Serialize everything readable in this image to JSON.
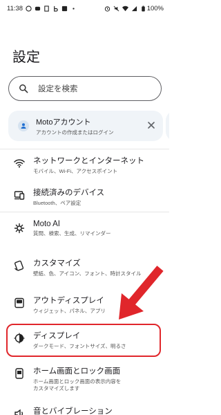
{
  "status_bar": {
    "time": "11:38",
    "battery": "100%",
    "icons_left": [
      "whatsapp-icon",
      "chat-icon",
      "doc-icon",
      "b-icon",
      "linkedin-icon",
      "dot-icon"
    ],
    "icons_right": [
      "alarm-icon",
      "mute-icon",
      "wifi-icon",
      "signal-icon",
      "battery-icon"
    ]
  },
  "header": {
    "title": "設定"
  },
  "search": {
    "placeholder": "設定を検索"
  },
  "account": {
    "title": "Motoアカウント",
    "subtitle": "アカウントの作成またはログイン"
  },
  "items": [
    {
      "title": "ネットワークとインターネット",
      "subtitle": "モバイル、Wi-Fi、アクセスポイント",
      "icon": "wifi-icon"
    },
    {
      "title": "接続済みのデバイス",
      "subtitle": "Bluetooth、ペア設定",
      "icon": "devices-icon"
    },
    {
      "title": "Moto AI",
      "subtitle": "質問、検索、生成、リマインダー",
      "icon": "moto-ai-icon"
    },
    {
      "title": "カスタマイズ",
      "subtitle": "壁紙、色、アイコン、フォント、時計スタイル",
      "icon": "customize-icon"
    },
    {
      "title": "アウトディスプレイ",
      "subtitle": "ウィジェット、パネル、アプリ",
      "icon": "out-display-icon"
    },
    {
      "title": "ディスプレイ",
      "subtitle": "ダークモード、フォントサイズ、明るさ",
      "icon": "display-icon"
    },
    {
      "title": "ホーム画面とロック画面",
      "subtitle": "ホーム画面とロック画面の表示内容を\nカスタマイズします",
      "icon": "home-lock-icon"
    },
    {
      "title": "音とバイブレーション",
      "subtitle": "",
      "icon": "sound-icon"
    }
  ],
  "colors": {
    "highlight": "#e0262b",
    "account_bg": "#f0f4f8"
  }
}
